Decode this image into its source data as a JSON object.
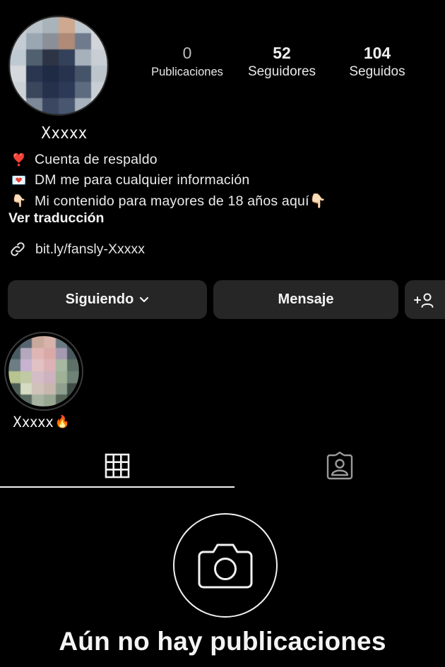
{
  "profile": {
    "username": "Xxxxx",
    "avatar_description": "pixelated-avatar"
  },
  "stats": [
    {
      "value": "0",
      "label": "Publicaciones"
    },
    {
      "value": "52",
      "label": "Seguidores"
    },
    {
      "value": "104",
      "label": "Seguidos"
    }
  ],
  "bio": {
    "lines": [
      {
        "emoji": "❣️",
        "text": "Cuenta de respaldo"
      },
      {
        "emoji": "💌",
        "text": "DM me para cualquier información"
      },
      {
        "emoji": "👇🏻",
        "text": "Mi contenido para mayores de 18 años aquí👇🏻"
      }
    ],
    "translate_label": "Ver traducción",
    "link": "bit.ly/fansly-Xxxxx"
  },
  "actions": {
    "following_label": "Siguiendo",
    "message_label": "Mensaje"
  },
  "highlights": [
    {
      "label": "Xxxxx",
      "emoji": "🔥"
    }
  ],
  "tabs": [
    {
      "icon": "grid-icon",
      "active": true
    },
    {
      "icon": "tagged-icon",
      "active": false
    }
  ],
  "empty_state": {
    "title": "Aún no hay publicaciones",
    "icon": "camera-icon"
  },
  "colors": {
    "background": "#000000",
    "button": "#262626",
    "text": "#f2f2f2"
  }
}
